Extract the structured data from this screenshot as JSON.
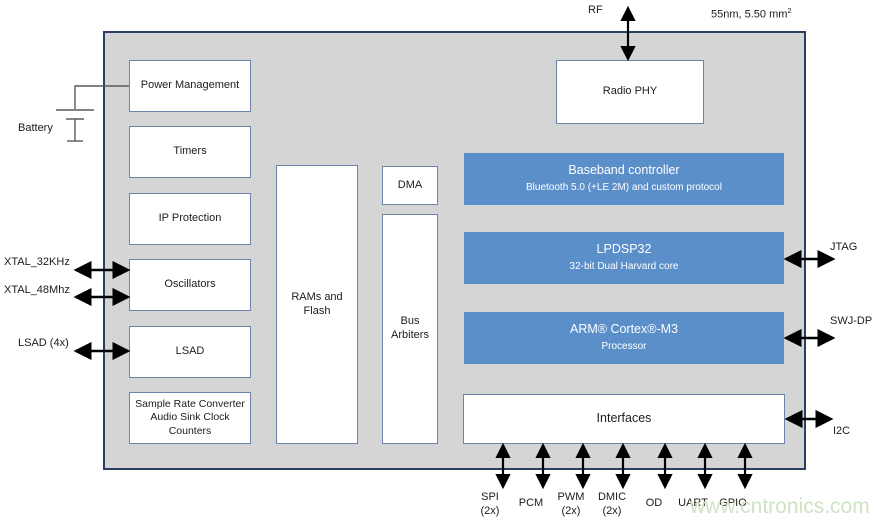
{
  "diagram": {
    "chip_note": "55nm, 5.50 mm",
    "chip_note_sup": "2",
    "watermark": "www.cntronics.com"
  },
  "left_column": {
    "power_management": "Power Management",
    "timers": "Timers",
    "ip_protection": "IP Protection",
    "oscillators": "Oscillators",
    "lsad": "LSAD",
    "src_line1": "Sample Rate Converter",
    "src_line2": "Audio Sink Clock Counters"
  },
  "memory_column": {
    "rams_line1": "RAMs and",
    "rams_line2": "Flash"
  },
  "bus_column": {
    "dma": "DMA",
    "bus_line1": "Bus",
    "bus_line2": "Arbiters"
  },
  "right_column": {
    "radio_phy": "Radio PHY",
    "baseband_title": "Baseband controller",
    "baseband_sub": "Bluetooth 5.0 (+LE 2M) and custom protocol",
    "lpdsp_title": "LPDSP32",
    "lpdsp_sub": "32-bit Dual Harvard core",
    "cortex_title": "ARM® Cortex®-M3",
    "cortex_sub": "Processor",
    "interfaces": "Interfaces"
  },
  "external_labels": {
    "battery": "Battery",
    "rf": "RF",
    "xtal_32khz": "XTAL_32KHz",
    "xtal_48mhz": "XTAL_48Mhz",
    "lsad_4x": "LSAD (4x)",
    "jtag": "JTAG",
    "swj_dp": "SWJ-DP",
    "i2c": "I2C"
  },
  "bottom_interfaces": [
    {
      "name": "SPI",
      "qty": "(2x)"
    },
    {
      "name": "PCM",
      "qty": ""
    },
    {
      "name": "PWM",
      "qty": "(2x)"
    },
    {
      "name": "DMIC",
      "qty": "(2x)"
    },
    {
      "name": "OD",
      "qty": ""
    },
    {
      "name": "UART",
      "qty": ""
    },
    {
      "name": "GPIO",
      "qty": ""
    }
  ],
  "colors": {
    "chip_fill": "#d5d5d5",
    "chip_border": "#2b3f63",
    "block_border": "#6b84ab",
    "accent_blue": "#5b8fc9",
    "watermark": "#cfe3c4"
  }
}
